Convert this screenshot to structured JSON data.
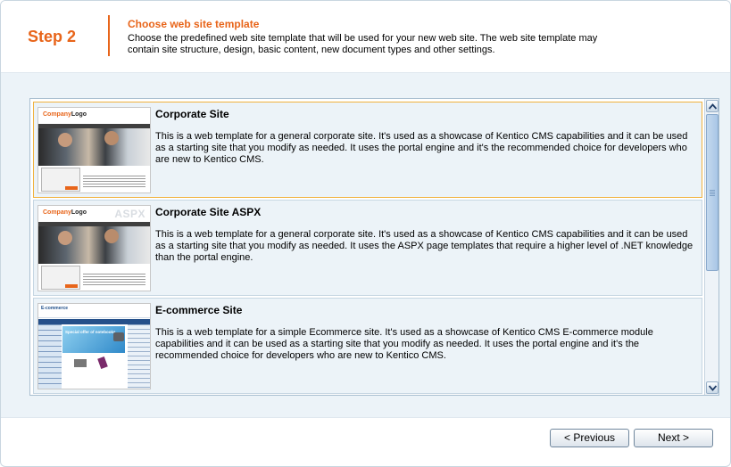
{
  "header": {
    "step": "Step 2",
    "title": "Choose web site template",
    "description": "Choose the predefined web site template that will be used for your new web site. The web site template may contain site structure, design, basic content, new document types and other settings."
  },
  "templates": [
    {
      "name": "Corporate Site",
      "description": "This is a web template for a general corporate site. It's used as a showcase of Kentico CMS capabilities and it can be used as a starting site that you modify as needed. It uses the portal engine and it's the recommended choice for developers who are new to Kentico CMS.",
      "selected": true,
      "thumbnail": {
        "logo_prefix": "Company",
        "logo_suffix": "Logo"
      }
    },
    {
      "name": "Corporate Site ASPX",
      "description": "This is a web template for a general corporate site. It's used as a showcase of Kentico CMS capabilities and it can be used as a starting site that you modify as needed. It uses the ASPX page templates that require a higher level of .NET knowledge than the portal engine.",
      "selected": false,
      "thumbnail": {
        "logo_prefix": "Company",
        "logo_suffix": "Logo",
        "watermark": "ASPX"
      }
    },
    {
      "name": "E-commerce Site",
      "description": "This is a web template for a simple Ecommerce site. It's used as a showcase of Kentico CMS E-commerce module capabilities and it can be used as a starting site that you modify as needed. It uses the portal engine and it's the recommended choice for developers who are new to Kentico CMS.",
      "selected": false,
      "thumbnail": {
        "logo_text": "E-commerce",
        "banner_text": "Special offer of notebooks"
      }
    }
  ],
  "buttons": {
    "previous": "< Previous",
    "next": "Next >"
  },
  "colors": {
    "accent": "#e8651a",
    "selected_border": "#f0b23e",
    "panel_background": "#ecf3f8"
  }
}
